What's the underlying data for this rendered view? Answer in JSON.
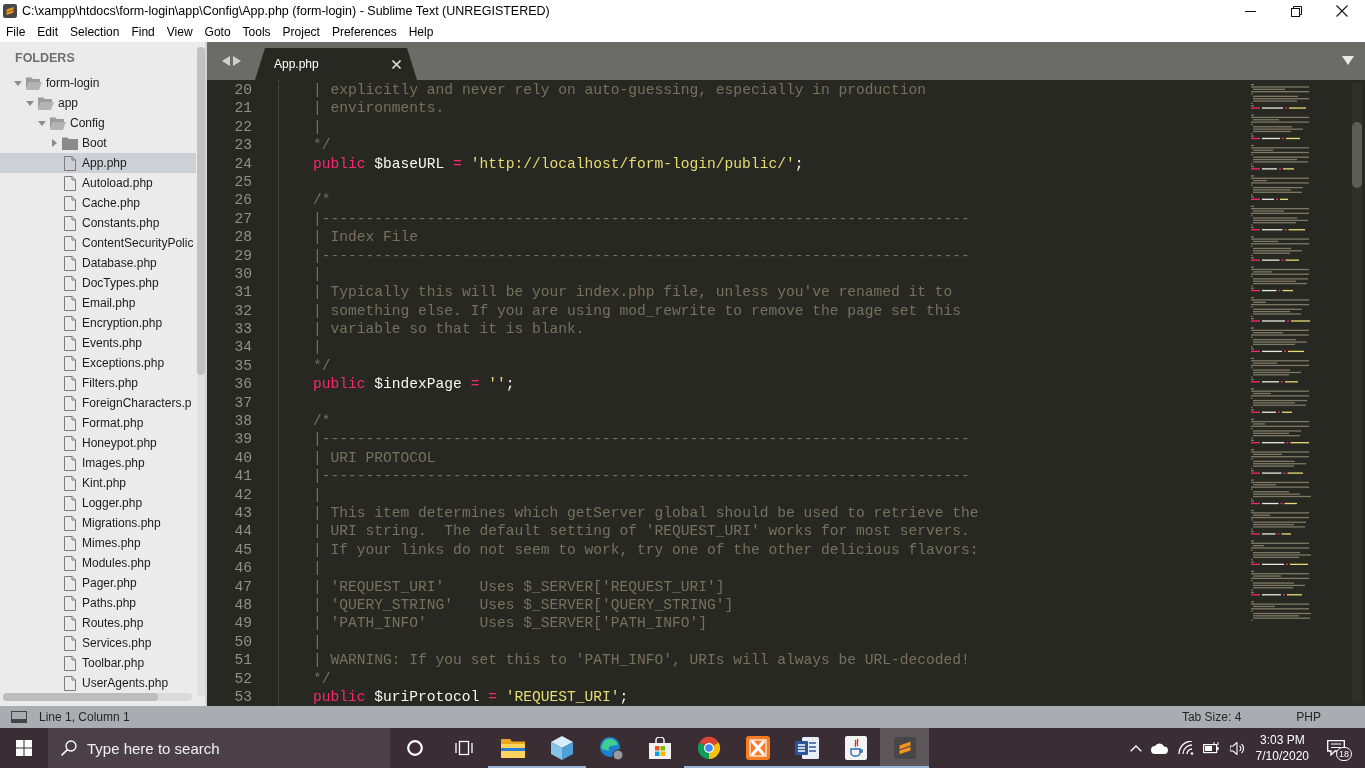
{
  "window": {
    "title": "C:\\xampp\\htdocs\\form-login\\app\\Config\\App.php (form-login) - Sublime Text (UNREGISTERED)"
  },
  "menu": [
    "File",
    "Edit",
    "Selection",
    "Find",
    "View",
    "Goto",
    "Tools",
    "Project",
    "Preferences",
    "Help"
  ],
  "sidebar": {
    "header": "FOLDERS",
    "tree": [
      {
        "kind": "folder",
        "name": "form-login",
        "expanded": true,
        "selected": false,
        "children": [
          {
            "kind": "folder",
            "name": "app",
            "expanded": true,
            "selected": false,
            "children": [
              {
                "kind": "folder",
                "name": "Config",
                "expanded": true,
                "selected": false,
                "children": [
                  {
                    "kind": "folder",
                    "name": "Boot",
                    "expanded": false,
                    "selected": false
                  },
                  {
                    "kind": "file",
                    "name": "App.php",
                    "selected": true
                  },
                  {
                    "kind": "file",
                    "name": "Autoload.php",
                    "selected": false
                  },
                  {
                    "kind": "file",
                    "name": "Cache.php",
                    "selected": false
                  },
                  {
                    "kind": "file",
                    "name": "Constants.php",
                    "selected": false
                  },
                  {
                    "kind": "file",
                    "name": "ContentSecurityPolic",
                    "selected": false
                  },
                  {
                    "kind": "file",
                    "name": "Database.php",
                    "selected": false
                  },
                  {
                    "kind": "file",
                    "name": "DocTypes.php",
                    "selected": false
                  },
                  {
                    "kind": "file",
                    "name": "Email.php",
                    "selected": false
                  },
                  {
                    "kind": "file",
                    "name": "Encryption.php",
                    "selected": false
                  },
                  {
                    "kind": "file",
                    "name": "Events.php",
                    "selected": false
                  },
                  {
                    "kind": "file",
                    "name": "Exceptions.php",
                    "selected": false
                  },
                  {
                    "kind": "file",
                    "name": "Filters.php",
                    "selected": false
                  },
                  {
                    "kind": "file",
                    "name": "ForeignCharacters.p",
                    "selected": false
                  },
                  {
                    "kind": "file",
                    "name": "Format.php",
                    "selected": false
                  },
                  {
                    "kind": "file",
                    "name": "Honeypot.php",
                    "selected": false
                  },
                  {
                    "kind": "file",
                    "name": "Images.php",
                    "selected": false
                  },
                  {
                    "kind": "file",
                    "name": "Kint.php",
                    "selected": false
                  },
                  {
                    "kind": "file",
                    "name": "Logger.php",
                    "selected": false
                  },
                  {
                    "kind": "file",
                    "name": "Migrations.php",
                    "selected": false
                  },
                  {
                    "kind": "file",
                    "name": "Mimes.php",
                    "selected": false
                  },
                  {
                    "kind": "file",
                    "name": "Modules.php",
                    "selected": false
                  },
                  {
                    "kind": "file",
                    "name": "Pager.php",
                    "selected": false
                  },
                  {
                    "kind": "file",
                    "name": "Paths.php",
                    "selected": false
                  },
                  {
                    "kind": "file",
                    "name": "Routes.php",
                    "selected": false
                  },
                  {
                    "kind": "file",
                    "name": "Services.php",
                    "selected": false
                  },
                  {
                    "kind": "file",
                    "name": "Toolbar.php",
                    "selected": false
                  },
                  {
                    "kind": "file",
                    "name": "UserAgents.php",
                    "selected": false
                  }
                ]
              }
            ]
          }
        ]
      }
    ]
  },
  "tabs": [
    {
      "label": "App.php",
      "selected": true
    }
  ],
  "editor": {
    "lines": [
      {
        "number": "20",
        "kind": "comment",
        "text": "| explicitly and never rely on auto-guessing, especially in production"
      },
      {
        "number": "21",
        "kind": "comment",
        "text": "| environments."
      },
      {
        "number": "22",
        "kind": "comment",
        "text": "|"
      },
      {
        "number": "23",
        "kind": "comment",
        "text": "*/"
      },
      {
        "number": "24",
        "kind": "code",
        "tokens": [
          {
            "kind": "keyword",
            "text": "public"
          },
          {
            "kind": "variable",
            "text": "$baseURL"
          },
          {
            "kind": "operator",
            "text": "="
          },
          {
            "kind": "string",
            "text": "'http://localhost/form-login/public/'"
          },
          {
            "kind": "punctuation",
            "text": ";"
          }
        ]
      },
      {
        "number": "25",
        "kind": "blank"
      },
      {
        "number": "26",
        "kind": "comment",
        "text": "/*"
      },
      {
        "number": "27",
        "kind": "comment",
        "text": "|--------------------------------------------------------------------------"
      },
      {
        "number": "28",
        "kind": "comment",
        "text": "| Index File"
      },
      {
        "number": "29",
        "kind": "comment",
        "text": "|--------------------------------------------------------------------------"
      },
      {
        "number": "30",
        "kind": "comment",
        "text": "|"
      },
      {
        "number": "31",
        "kind": "comment",
        "text": "| Typically this will be your index.php file, unless you've renamed it to"
      },
      {
        "number": "32",
        "kind": "comment",
        "text": "| something else. If you are using mod_rewrite to remove the page set this"
      },
      {
        "number": "33",
        "kind": "comment",
        "text": "| variable so that it is blank."
      },
      {
        "number": "34",
        "kind": "comment",
        "text": "|"
      },
      {
        "number": "35",
        "kind": "comment",
        "text": "*/"
      },
      {
        "number": "36",
        "kind": "code",
        "tokens": [
          {
            "kind": "keyword",
            "text": "public"
          },
          {
            "kind": "variable",
            "text": "$indexPage"
          },
          {
            "kind": "operator",
            "text": "="
          },
          {
            "kind": "string",
            "text": "''"
          },
          {
            "kind": "punctuation",
            "text": ";"
          }
        ]
      },
      {
        "number": "37",
        "kind": "blank"
      },
      {
        "number": "38",
        "kind": "comment",
        "text": "/*"
      },
      {
        "number": "39",
        "kind": "comment",
        "text": "|--------------------------------------------------------------------------"
      },
      {
        "number": "40",
        "kind": "comment",
        "text": "| URI PROTOCOL"
      },
      {
        "number": "41",
        "kind": "comment",
        "text": "|--------------------------------------------------------------------------"
      },
      {
        "number": "42",
        "kind": "comment",
        "text": "|"
      },
      {
        "number": "43",
        "kind": "comment",
        "text": "| This item determines which getServer global should be used to retrieve the"
      },
      {
        "number": "44",
        "kind": "comment",
        "text": "| URI string.  The default setting of 'REQUEST_URI' works for most servers."
      },
      {
        "number": "45",
        "kind": "comment",
        "text": "| If your links do not seem to work, try one of the other delicious flavors:"
      },
      {
        "number": "46",
        "kind": "comment",
        "text": "|"
      },
      {
        "number": "47",
        "kind": "comment",
        "text": "| 'REQUEST_URI'    Uses $_SERVER['REQUEST_URI']"
      },
      {
        "number": "48",
        "kind": "comment",
        "text": "| 'QUERY_STRING'   Uses $_SERVER['QUERY_STRING']"
      },
      {
        "number": "49",
        "kind": "comment",
        "text": "| 'PATH_INFO'      Uses $_SERVER['PATH_INFO']"
      },
      {
        "number": "50",
        "kind": "comment",
        "text": "|"
      },
      {
        "number": "51",
        "kind": "comment",
        "text": "| WARNING: If you set this to 'PATH_INFO', URIs will always be URL-decoded!"
      },
      {
        "number": "52",
        "kind": "comment",
        "text": "*/"
      },
      {
        "number": "53",
        "kind": "code",
        "tokens": [
          {
            "kind": "keyword",
            "text": "public"
          },
          {
            "kind": "variable",
            "text": "$uriProtocol"
          },
          {
            "kind": "operator",
            "text": "="
          },
          {
            "kind": "string",
            "text": "'REQUEST_URI'"
          },
          {
            "kind": "punctuation",
            "text": ";"
          }
        ]
      }
    ]
  },
  "status_bar": {
    "position": "Line 1, Column 1",
    "tab_size": "Tab Size: 4",
    "syntax": "PHP"
  },
  "taskbar": {
    "search": {
      "placeholder": "Type here to search"
    },
    "apps": [
      {
        "kind": "folder",
        "running": true,
        "active": false
      },
      {
        "kind": "cube",
        "running": true,
        "active": false
      },
      {
        "kind": "swirl",
        "running": false,
        "active": false
      },
      {
        "kind": "bag",
        "running": false,
        "active": false
      },
      {
        "kind": "wheel",
        "running": true,
        "active": false
      },
      {
        "kind": "cross",
        "running": true,
        "active": false
      },
      {
        "kind": "document",
        "running": true,
        "active": false
      },
      {
        "kind": "cup",
        "running": true,
        "active": false
      },
      {
        "kind": "logo",
        "running": true,
        "active": true
      }
    ],
    "time": "3:03 PM",
    "date": "7/10/2020",
    "notification_count": "18"
  }
}
